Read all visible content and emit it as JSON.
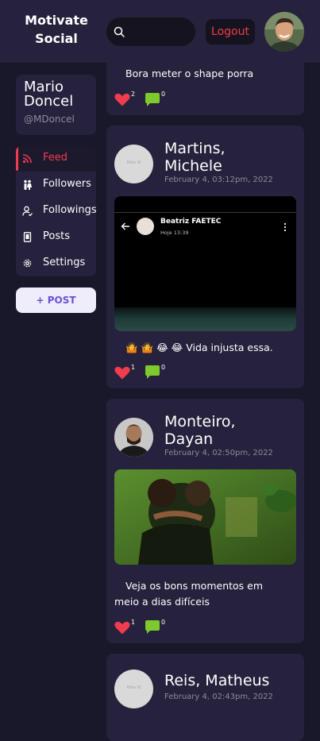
{
  "header": {
    "brand_line1": "Motivate",
    "brand_line2": "Social",
    "logout_label": "Logout"
  },
  "sidebar": {
    "profile": {
      "first_name": "Mario",
      "last_name": "Doncel",
      "handle": "@MDoncel"
    },
    "nav": [
      {
        "label": "Feed",
        "icon": "rss-icon",
        "active": true
      },
      {
        "label": "Followers",
        "icon": "followers-icon"
      },
      {
        "label": "Followings",
        "icon": "following-icon"
      },
      {
        "label": "Posts",
        "icon": "posts-icon"
      },
      {
        "label": "Settings",
        "icon": "gear-icon"
      }
    ],
    "post_button_label": "+ POST"
  },
  "posts": [
    {
      "text": "Bora meter o shape porra",
      "likes": "2",
      "comments": "0"
    },
    {
      "author_line1": "Martins,",
      "author_line2": "Michele",
      "date": "February 4, 03:12pm, 2022",
      "avatar_placeholder": "Mike W",
      "media": {
        "contact_name": "Beatriz FAETEC",
        "contact_status": "Hoje 13:39"
      },
      "text": "🤷 🤷 😂 😂  Vida injusta essa.",
      "likes": "1",
      "comments": "0"
    },
    {
      "author_line1": "Monteiro,",
      "author_line2": "Dayan",
      "date": "February 4, 02:50pm, 2022",
      "text_line1": "Veja os bons momentos em",
      "text_line2": "meio a dias difíceis",
      "likes": "1",
      "comments": "0"
    },
    {
      "author_line1": "Reis, Matheus",
      "date": "February 4, 02:43pm, 2022",
      "avatar_placeholder": "Mike W"
    }
  ],
  "colors": {
    "accent": "#ef3d4e",
    "comment_green": "#7ec92d",
    "card_bg": "#26213c",
    "page_bg": "#19172a"
  }
}
